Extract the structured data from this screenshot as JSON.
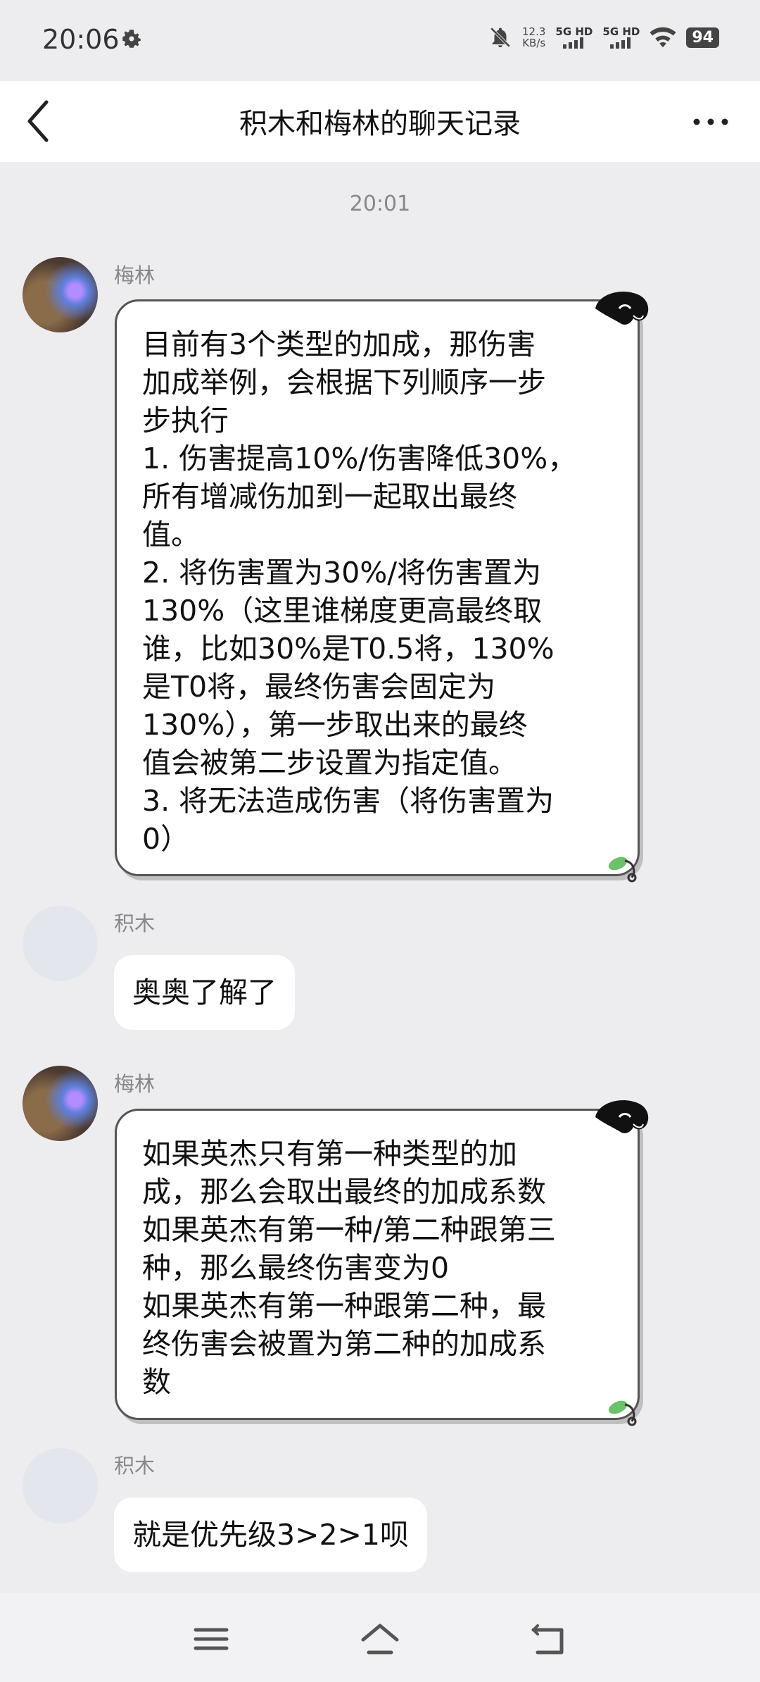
{
  "status_bar": {
    "time": "20:06",
    "net_speed_value": "12.3",
    "net_speed_unit": "KB/s",
    "signal1": "5G HD",
    "signal2": "5G HD",
    "battery": "94"
  },
  "header": {
    "title": "积木和梅林的聊天记录"
  },
  "chat": {
    "timestamp": "20:01",
    "messages": [
      {
        "sender": "梅林",
        "text": "目前有3个类型的加成，那伤害\n加成举例，会根据下列顺序一步\n步执行\n1. 伤害提高10%/伤害降低30%，\n所有增减伤加到一起取出最终\n值。\n2. 将伤害置为30%/将伤害置为\n130%（这里谁梯度更高最终取\n谁，比如30%是T0.5将，130%\n是T0将，最终伤害会固定为\n130%），第一步取出来的最终\n值会被第二步设置为指定值。\n3. 将无法造成伤害（将伤害置为\n0）"
      },
      {
        "sender": "积木",
        "text": "奥奥了解了"
      },
      {
        "sender": "梅林",
        "text": "如果英杰只有第一种类型的加\n成，那么会取出最终的加成系数\n如果英杰有第一种/第二种跟第三\n种，那么最终伤害变为0\n如果英杰有第一种跟第二种，最\n终伤害会被置为第二种的加成系\n数"
      },
      {
        "sender": "积木",
        "text": "就是优先级3>2>1呗"
      }
    ]
  },
  "icons": {
    "back": "back-arrow-icon",
    "more": "more-dots-icon",
    "gear": "gear-icon",
    "nav_menu": "menu-icon",
    "nav_home": "home-icon",
    "nav_back": "return-icon"
  }
}
